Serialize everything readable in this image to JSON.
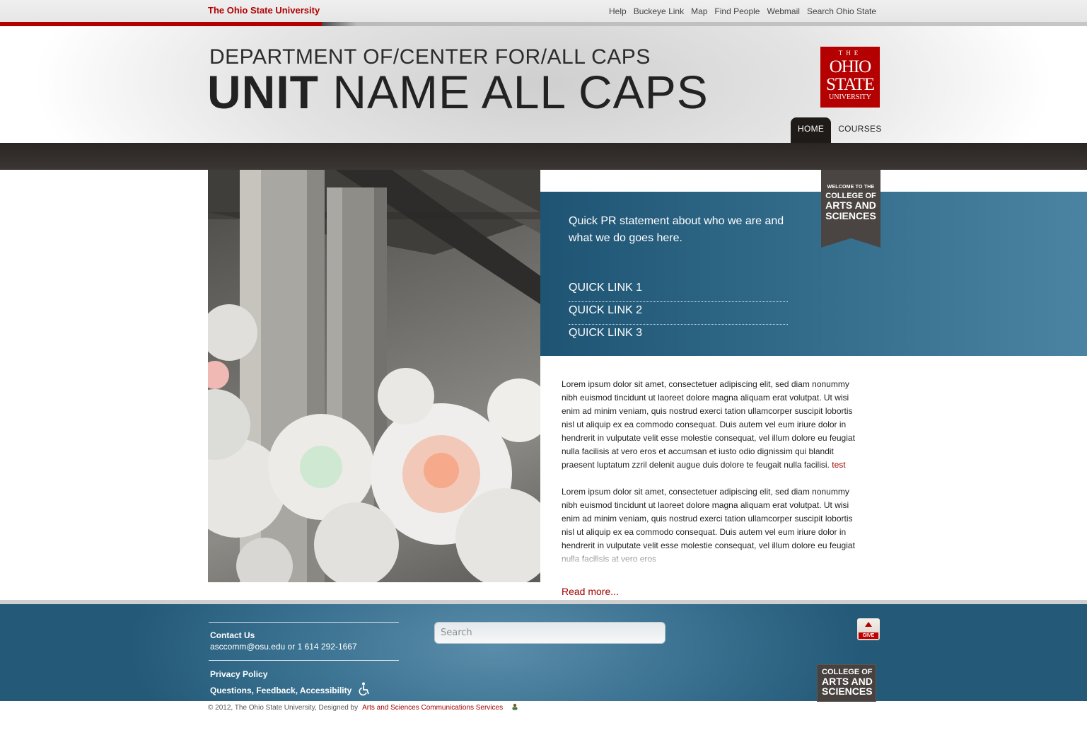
{
  "topbar": {
    "wordmark": "The Ohio State University",
    "links": [
      "Help",
      "Buckeye Link",
      "Map",
      "Find People",
      "Webmail",
      "Search Ohio State"
    ]
  },
  "header": {
    "dept": "DEPARTMENT OF/CENTER FOR/ALL CAPS",
    "unit_bold": "UNIT",
    "unit_rest": " NAME ALL CAPS",
    "logo": {
      "line1": "THE",
      "line2": "OHIO",
      "line3": "STATE",
      "line4": "UNIVERSITY"
    }
  },
  "nav": {
    "home": "HOME",
    "courses": "COURSES"
  },
  "hero": {
    "pr": "Quick PR statement about who we are and what we do goes here.",
    "quicklinks": [
      "QUICK LINK 1",
      "QUICK LINK 2",
      "QUICK LINK 3"
    ],
    "ribbon": {
      "line1": "WELCOME TO THE",
      "line2": "COLLEGE OF",
      "line3": "ARTS AND",
      "line4": "SCIENCES"
    }
  },
  "content": {
    "para1": "Lorem ipsum dolor sit amet, consectetuer adipiscing elit, sed diam nonummy nibh euismod tincidunt ut laoreet dolore magna aliquam erat volutpat. Ut wisi enim ad minim veniam, quis nostrud exerci tation ullamcorper suscipit lobortis nisl ut aliquip ex ea commodo consequat. Duis autem vel eum iriure dolor in hendrerit in vulputate velit esse molestie consequat, vel illum dolore eu feugiat nulla facilisis at vero eros et accumsan et iusto odio dignissim qui blandit praesent luptatum zzril delenit augue duis dolore te feugait nulla facilisi.",
    "para1_link": "test",
    "para2": "Lorem ipsum dolor sit amet, consectetuer adipiscing elit, sed diam nonummy nibh euismod tincidunt ut laoreet dolore magna aliquam erat volutpat. Ut wisi enim ad minim veniam, quis nostrud exerci tation ullamcorper suscipit lobortis nisl ut aliquip ex ea commodo consequat. Duis autem vel eum iriure dolor in hendrerit in vulputate velit esse molestie consequat, vel illum dolore eu feugiat nulla facilisis at vero eros",
    "read_more": "Read more..."
  },
  "footer": {
    "contact_title": "Contact Us",
    "contact_info": "asccomm@osu.edu or 1 614 292-1667",
    "privacy": "Privacy Policy",
    "questions": "Questions, Feedback, Accessibility",
    "search_placeholder": "Search",
    "give_label": "GIVE",
    "logo": {
      "line1": "COLLEGE OF",
      "line2": "ARTS AND",
      "line3": "SCIENCES"
    },
    "copyright": "© 2012, The Ohio State University, Designed by",
    "designer": "Arts and Sciences Communications Services"
  },
  "colors": {
    "scarlet": "#b00000",
    "teal_blue": "#2f6887",
    "dark_bar": "#2a2624"
  },
  "icons": [
    "wheelchair-accessibility-icon",
    "give-capitol-icon",
    "person-icon"
  ]
}
